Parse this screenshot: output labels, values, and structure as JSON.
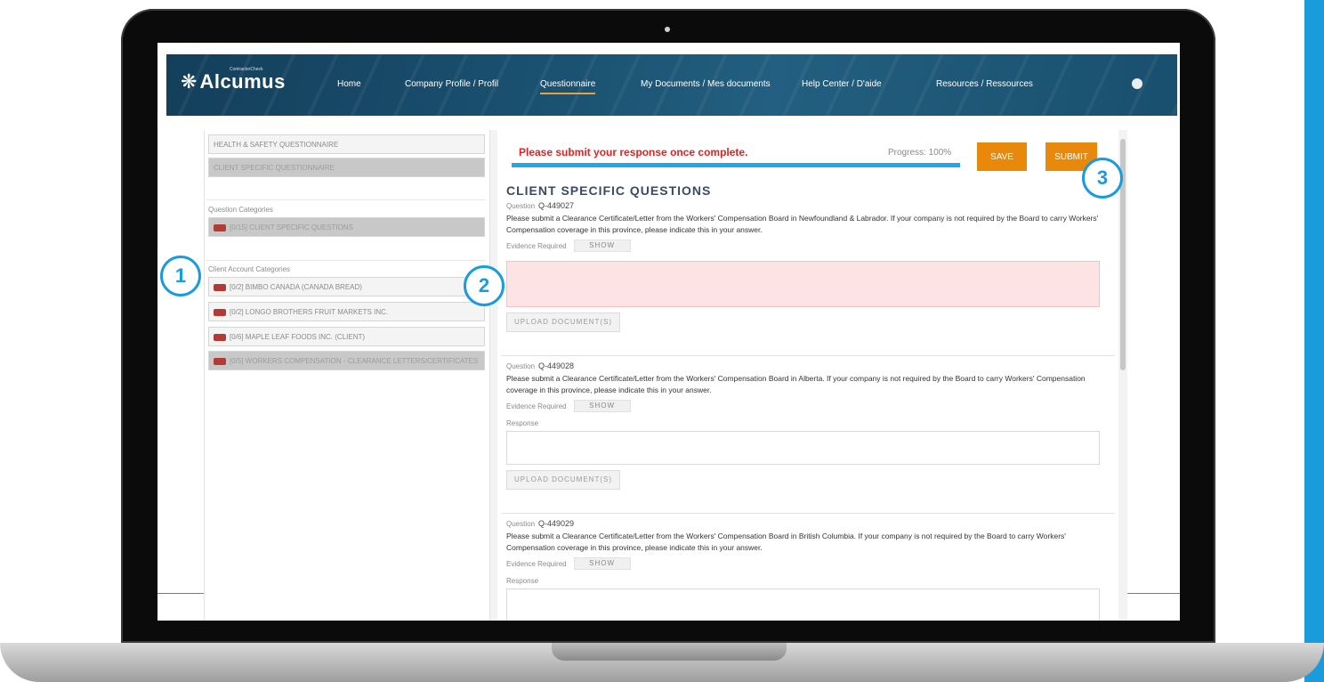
{
  "nav": {
    "logo_text": "Alcumus",
    "logo_sub": "ContractorCheck",
    "items": [
      {
        "label": "Home",
        "active": false
      },
      {
        "label": "Company Profile / Profil",
        "active": false
      },
      {
        "label": "Questionnaire",
        "active": true
      },
      {
        "label": "My Documents / Mes documents",
        "active": false
      },
      {
        "label": "Help Center / D'aide",
        "active": false
      },
      {
        "label": "Resources / Ressources",
        "active": false
      }
    ]
  },
  "left": {
    "questionnaires": [
      "HEALTH & SAFETY QUESTIONNAIRE",
      "CLIENT SPECIFIC QUESTIONNAIRE"
    ],
    "question_categories_title": "Question Categories",
    "question_categories": [
      "[0/15] CLIENT SPECIFIC QUESTIONS"
    ],
    "client_categories_title": "Client Account Categories",
    "client_categories": [
      "[0/2] BIMBO CANADA (CANADA BREAD)",
      "[0/2] LONGO BROTHERS FRUIT MARKETS INC.",
      "[0/6] MAPLE LEAF FOODS INC. (CLIENT)",
      "[0/5] WORKERS COMPENSATION - CLEARANCE LETTERS/CERTIFICATES"
    ]
  },
  "main": {
    "submit_message": "Please submit your response once complete.",
    "progress_label": "Progress: 100%",
    "progress_value": 1.0,
    "save_label": "SAVE",
    "submit_label": "SUBMIT",
    "section_title": "CLIENT SPECIFIC QUESTIONS",
    "question_label": "Question",
    "evidence_label": "Evidence Required",
    "show_label": "SHOW",
    "response_label": "Response",
    "upload_label": "UPLOAD DOCUMENT(S)",
    "questions": [
      {
        "id": "Q-449027",
        "text": "Please submit a Clearance Certificate/Letter from the Workers' Compensation Board in Newfoundland & Labrador. If your company is not required by the Board to carry Workers' Compensation coverage in this province, please indicate this in your answer."
      },
      {
        "id": "Q-449028",
        "text": "Please submit a Clearance Certificate/Letter from the Workers' Compensation Board in Alberta. If your company is not required by the Board to carry Workers' Compensation coverage in this province, please indicate this in your answer."
      },
      {
        "id": "Q-449029",
        "text": "Please submit a Clearance Certificate/Letter from the Workers' Compensation Board in British Columbia. If your company is not required by the Board to carry Workers' Compensation coverage in this province, please indicate this in your answer."
      }
    ]
  },
  "callouts": [
    "1",
    "2",
    "3"
  ],
  "colors": {
    "accent": "#1a9bdc",
    "orange": "#e8890c",
    "error": "#e52020",
    "badge": "#b23b35"
  }
}
